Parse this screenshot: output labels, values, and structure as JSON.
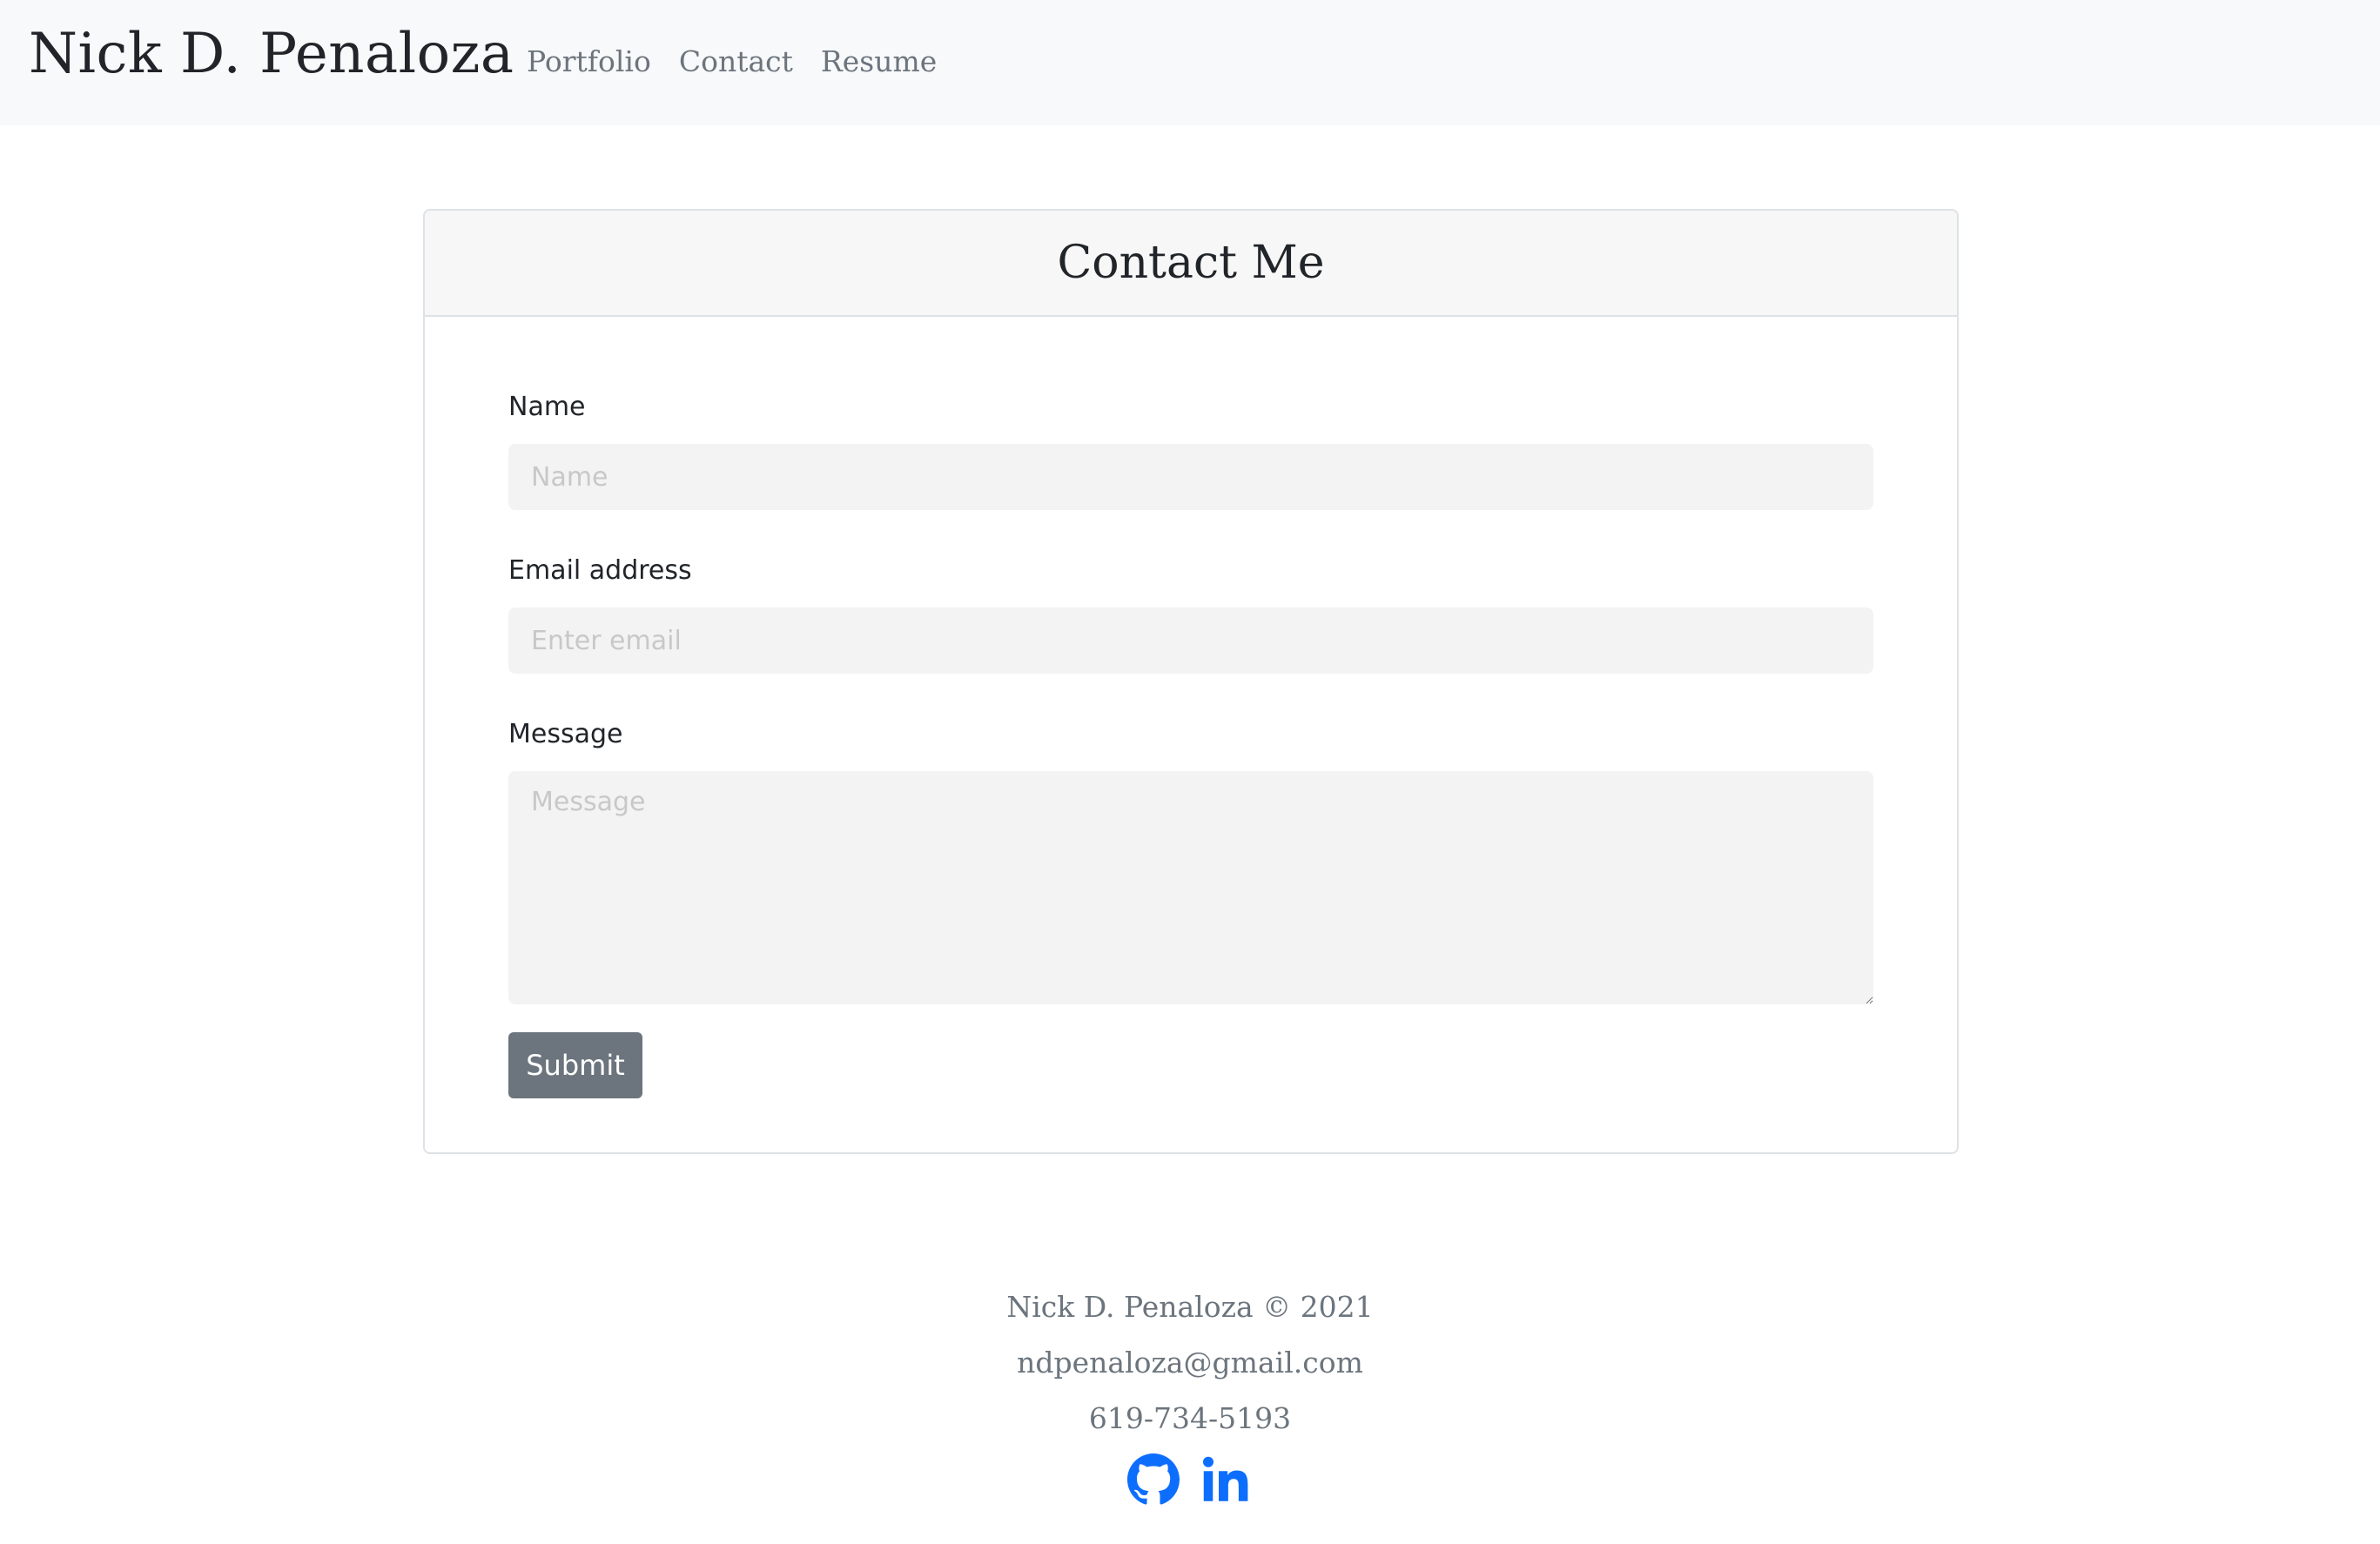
{
  "navbar": {
    "brand": "Nick D. Penaloza",
    "links": [
      "Portfolio",
      "Contact",
      "Resume"
    ]
  },
  "contact": {
    "title": "Contact Me",
    "name_label": "Name",
    "name_placeholder": "Name",
    "email_label": "Email address",
    "email_placeholder": "Enter email",
    "message_label": "Message",
    "message_placeholder": "Message",
    "submit_label": "Submit"
  },
  "footer": {
    "copyright": "Nick D. Penaloza © 2021",
    "email": "ndpenaloza@gmail.com",
    "phone": "619-734-5193",
    "socials": [
      {
        "icon": "github-icon"
      },
      {
        "icon": "linkedin-icon"
      }
    ]
  },
  "colors": {
    "link_blue": "#0d6efd",
    "button_gray": "#6c757d",
    "navbar_bg": "#f8f9fa"
  }
}
